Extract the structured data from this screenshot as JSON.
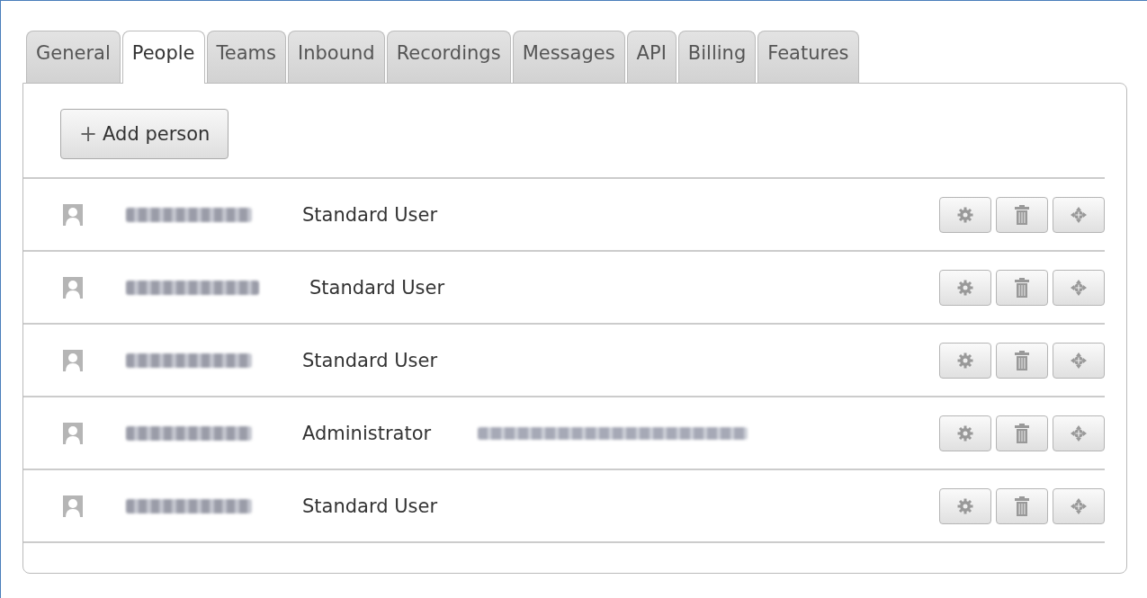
{
  "tabs": [
    {
      "label": "General",
      "selected": false
    },
    {
      "label": "People",
      "selected": true
    },
    {
      "label": "Teams",
      "selected": false
    },
    {
      "label": "Inbound",
      "selected": false
    },
    {
      "label": "Recordings",
      "selected": false
    },
    {
      "label": "Messages",
      "selected": false
    },
    {
      "label": "API",
      "selected": false
    },
    {
      "label": "Billing",
      "selected": false
    },
    {
      "label": "Features",
      "selected": false
    }
  ],
  "add_button": {
    "icon": "+",
    "label": "Add person"
  },
  "people": [
    {
      "role": "Standard User",
      "email_redacted": false
    },
    {
      "role": "Standard User",
      "email_redacted": false
    },
    {
      "role": "Standard User",
      "email_redacted": false
    },
    {
      "role": "Administrator",
      "email_redacted": true
    },
    {
      "role": "Standard User",
      "email_redacted": false
    }
  ]
}
